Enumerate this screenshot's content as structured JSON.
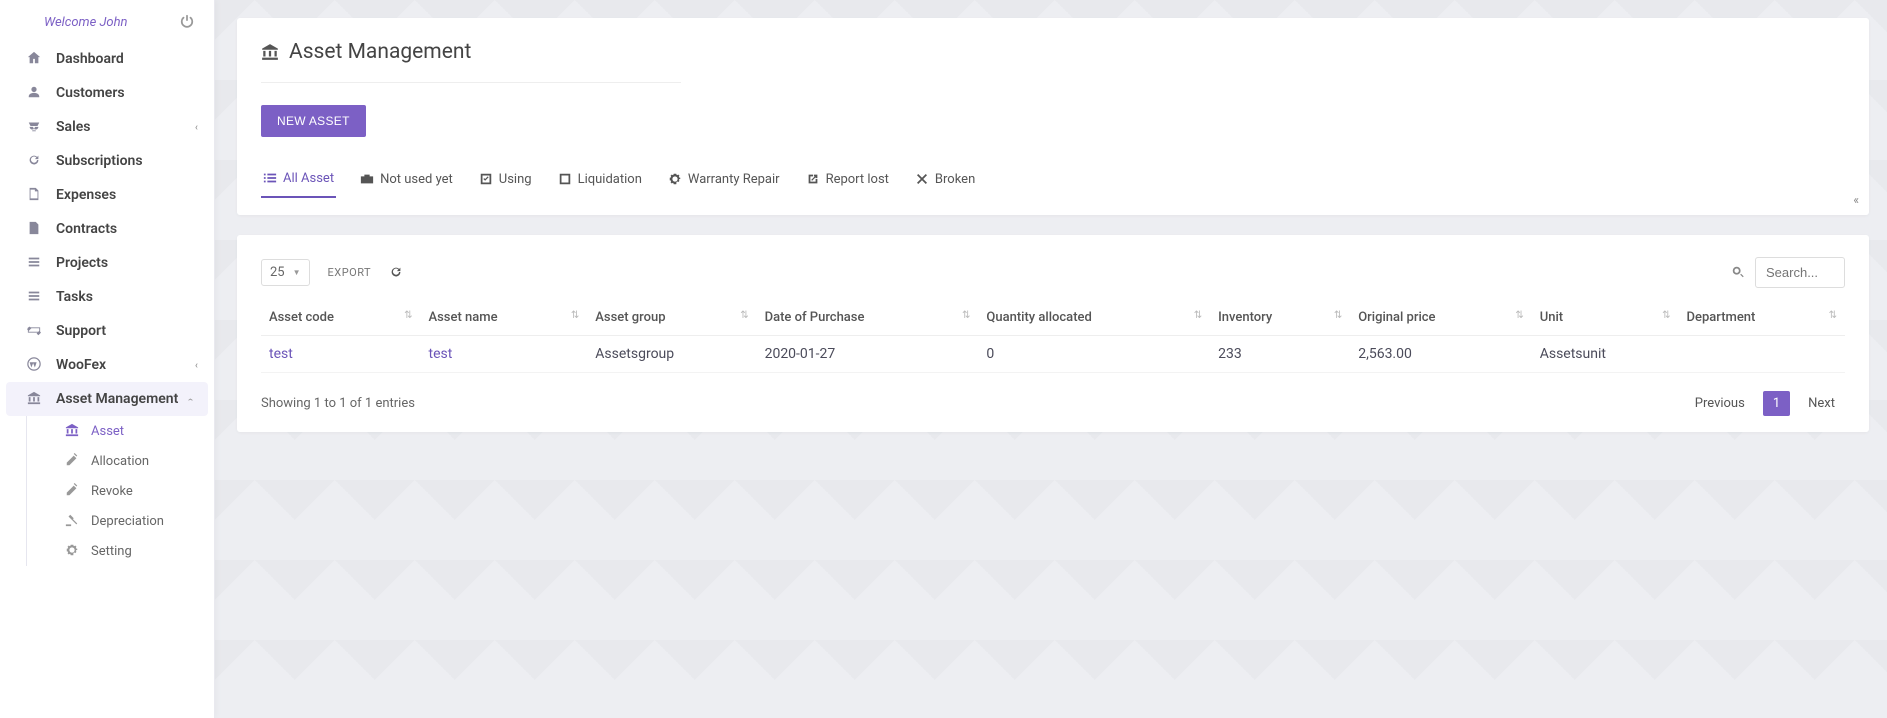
{
  "welcome": {
    "text": "Welcome John"
  },
  "sidebar": {
    "items": [
      {
        "label": "Dashboard"
      },
      {
        "label": "Customers"
      },
      {
        "label": "Sales"
      },
      {
        "label": "Subscriptions"
      },
      {
        "label": "Expenses"
      },
      {
        "label": "Contracts"
      },
      {
        "label": "Projects"
      },
      {
        "label": "Tasks"
      },
      {
        "label": "Support"
      },
      {
        "label": "WooFex"
      },
      {
        "label": "Asset Management"
      }
    ],
    "asset_sub": [
      {
        "label": "Asset"
      },
      {
        "label": "Allocation"
      },
      {
        "label": "Revoke"
      },
      {
        "label": "Depreciation"
      },
      {
        "label": "Setting"
      }
    ]
  },
  "page": {
    "title": "Asset Management",
    "new_button": "NEW ASSET"
  },
  "tabs": [
    {
      "label": "All Asset"
    },
    {
      "label": "Not used yet"
    },
    {
      "label": "Using"
    },
    {
      "label": "Liquidation"
    },
    {
      "label": "Warranty Repair"
    },
    {
      "label": "Report lost"
    },
    {
      "label": "Broken"
    }
  ],
  "table": {
    "page_size": "25",
    "export_label": "EXPORT",
    "search_placeholder": "Search...",
    "columns": [
      "Asset code",
      "Asset name",
      "Asset group",
      "Date of Purchase",
      "Quantity allocated",
      "Inventory",
      "Original price",
      "Unit",
      "Department"
    ],
    "rows": [
      {
        "asset_code": "test",
        "asset_name": "test",
        "asset_group": "Assetsgroup",
        "date_of_purchase": "2020-01-27",
        "quantity_allocated": "0",
        "inventory": "233",
        "original_price": "2,563.00",
        "unit": "Assetsunit",
        "department": ""
      }
    ],
    "info_text": "Showing 1 to 1 of 1 entries",
    "pager": {
      "prev": "Previous",
      "current": "1",
      "next": "Next"
    }
  }
}
